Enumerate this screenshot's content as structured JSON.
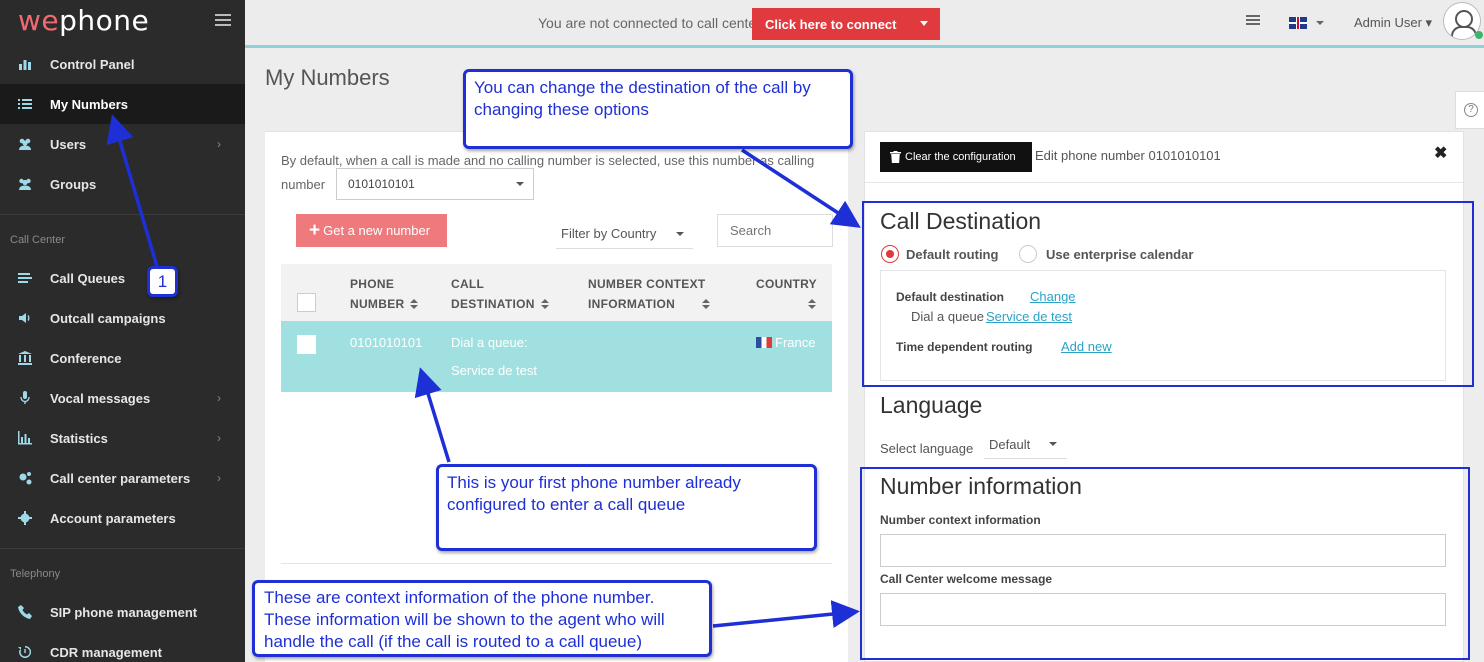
{
  "app": {
    "logo_left": "we",
    "logo_right": "phone"
  },
  "sidebar": {
    "items": [
      {
        "label": "Control Panel",
        "icon": "bar-chart-icon"
      },
      {
        "label": "My Numbers",
        "icon": "list-icon",
        "active": true
      },
      {
        "label": "Users",
        "icon": "users-icon",
        "has_submenu": true
      },
      {
        "label": "Groups",
        "icon": "group-icon"
      }
    ],
    "call_center_label": "Call Center",
    "call_center_items": [
      {
        "label": "Call Queues",
        "icon": "queue-list-icon"
      },
      {
        "label": "Outcall campaigns",
        "icon": "volume-icon"
      },
      {
        "label": "Conference",
        "icon": "bank-icon"
      },
      {
        "label": "Vocal messages",
        "icon": "microphone-icon",
        "has_submenu": true
      },
      {
        "label": "Statistics",
        "icon": "statistics-icon",
        "has_submenu": true
      },
      {
        "label": "Call center parameters",
        "icon": "cogs-icon",
        "has_submenu": true
      },
      {
        "label": "Account parameters",
        "icon": "gear-icon"
      }
    ],
    "telephony_label": "Telephony",
    "telephony_items": [
      {
        "label": "SIP phone management",
        "icon": "phone-icon"
      },
      {
        "label": "CDR management",
        "icon": "history-icon"
      }
    ]
  },
  "topbar": {
    "status_text": "You are not connected to call center",
    "connect_label": "Click here to connect",
    "user_label": "Admin User"
  },
  "page": {
    "title": "My Numbers"
  },
  "numbers": {
    "default_text": "By default, when a call is made and no calling number is selected, use this number as calling number",
    "default_number": "0101010101",
    "get_number_label": "Get a new number",
    "filter_label": "Filter by Country",
    "search_placeholder": "Search",
    "columns": {
      "phone_1": "PHONE",
      "phone_2": "NUMBER",
      "dest_1": "CALL",
      "dest_2": "DESTINATION",
      "ctx_1": "NUMBER CONTEXT",
      "ctx_2": "INFORMATION",
      "country": "COUNTRY"
    },
    "rows": [
      {
        "phone": "0101010101",
        "dest_1": "Dial a queue:",
        "dest_2": "Service de test",
        "country": "France"
      }
    ]
  },
  "editor": {
    "clear_label": "Clear the configuration",
    "title": "Edit phone number 0101010101",
    "close": "✖",
    "call_destination_title": "Call Destination",
    "routing_default": "Default routing",
    "routing_calendar": "Use enterprise calendar",
    "default_destination_label": "Default destination",
    "change_link": "Change",
    "dial_text": "Dial a queue",
    "queue_link": "Service de test",
    "time_routing_label": "Time dependent routing",
    "add_new_link": "Add new",
    "language_title": "Language",
    "select_language_label": "Select language",
    "language_value": "Default",
    "number_info_title": "Number information",
    "context_info_label": "Number context information",
    "welcome_label": "Call Center welcome message",
    "help": "?"
  },
  "annotations": {
    "step": "1",
    "destination_note": "You can change the destination of the call by changing these options",
    "first_number_note": "This is your first phone number already configured to enter a call queue",
    "context_note": "These are context information of the phone number. These information will be shown to the agent who will handle the call (if the call is routed to a call queue)"
  },
  "colors": {
    "accent_red": "#e0393e",
    "row_highlight": "#a0e0e0",
    "annotation_blue": "#1e2fd6",
    "sidebar_bg": "#2b2b2b"
  }
}
